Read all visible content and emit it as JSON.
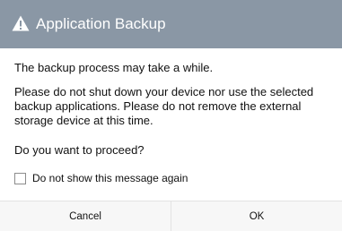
{
  "dialog": {
    "title": "Application Backup",
    "icon": "warning-icon",
    "header_color": "#8a97a5",
    "message_1": "The backup process may take a while.",
    "message_2": "Please do not shut down your device nor use the selected backup applications. Please do not remove the external storage device at this time.",
    "question": "Do you want to proceed?",
    "checkbox_label": "Do not show this message again",
    "checkbox_checked": false,
    "cancel_label": "Cancel",
    "ok_label": "OK"
  }
}
